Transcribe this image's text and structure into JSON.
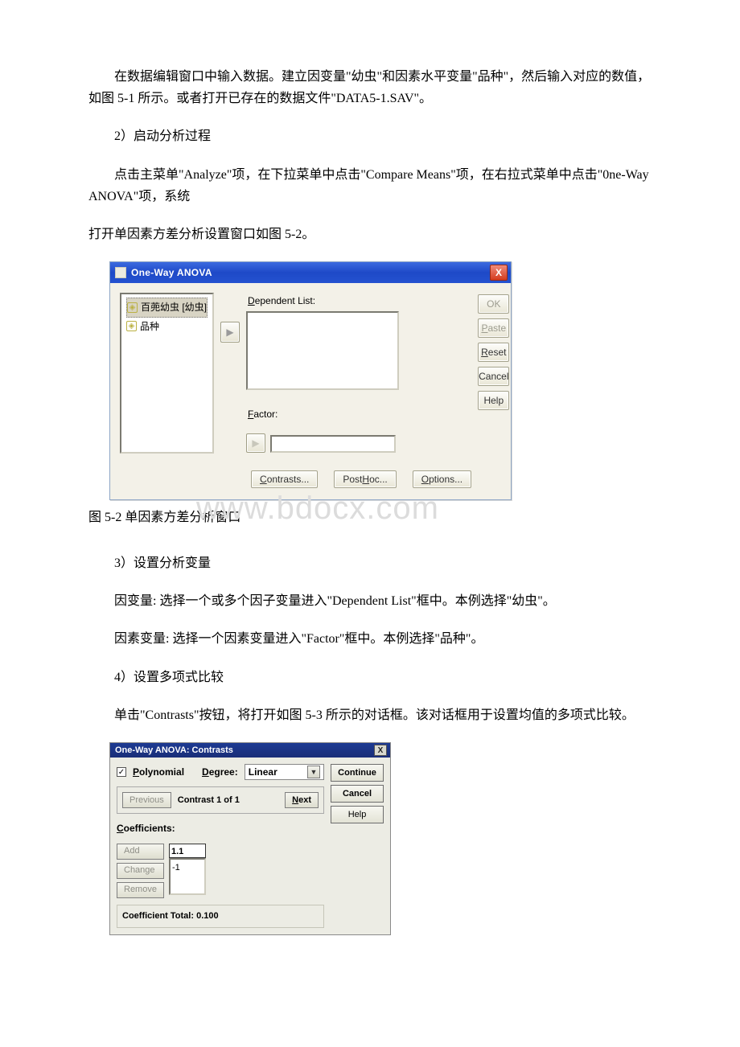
{
  "paragraphs": {
    "p1": "在数据编辑窗口中输入数据。建立因变量\"幼虫\"和因素水平变量\"品种\"，然后输入对应的数值，如图 5-1 所示。或者打开已存在的数据文件\"DATA5-1.SAV\"。",
    "p2": "2）启动分析过程",
    "p3": "点击主菜单\"Analyze\"项，在下拉菜单中点击\"Compare Means\"项，在右拉式菜单中点击\"0ne-Way ANOVA\"项，系统",
    "p3b": "打开单因素方差分析设置窗口如图 5-2。",
    "caption1": "图 5-2 单因素方差分析窗口",
    "p4": "3）设置分析变量",
    "p5": "因变量: 选择一个或多个因子变量进入\"Dependent List\"框中。本例选择\"幼虫\"。",
    "p6": "因素变量: 选择一个因素变量进入\"Factor\"框中。本例选择\"品种\"。",
    "p7": "4）设置多项式比较",
    "p8": "单击\"Contrasts\"按钮，将打开如图 5-3 所示的对话框。该对话框用于设置均值的多项式比较。"
  },
  "watermark": "www.bdocx.com",
  "dialog1": {
    "title": "One-Way ANOVA",
    "close": "X",
    "vars": {
      "v1": "百蔸幼虫 [幼虫]",
      "v2": "品种"
    },
    "dep_label_pre": "D",
    "dep_label_rest": "ependent List:",
    "fac_label_pre": "F",
    "fac_label_rest": "actor:",
    "buttons": {
      "ok": "OK",
      "paste_pre": "P",
      "paste_rest": "aste",
      "reset_pre": "R",
      "reset_rest": "eset",
      "cancel": "Cancel",
      "help": "Help",
      "contrasts_pre": "C",
      "contrasts_rest": "ontrasts...",
      "posthoc_pre1": "Post ",
      "posthoc_u": "H",
      "posthoc_rest": "oc...",
      "options_pre": "O",
      "options_rest": "ptions..."
    }
  },
  "dialog2": {
    "title": "One-Way ANOVA: Contrasts",
    "close": "X",
    "polynomial_pre": "P",
    "polynomial_rest": "olynomial",
    "degree_pre": "D",
    "degree_rest": "egree:",
    "degree_value": "Linear",
    "previous": "Previous",
    "contrast_counter": "Contrast 1 of 1",
    "next_pre": "N",
    "next_rest": "ext",
    "coeff_label_pre": "C",
    "coeff_label_rest": "oefficients:",
    "btn_add": "Add",
    "btn_change": "Change",
    "btn_remove": "Remove",
    "coef_field": "1.1",
    "coef_list": "-1",
    "total": "Coefficient Total: 0.100",
    "continue": "Continue",
    "cancel": "Cancel",
    "help": "Help"
  }
}
